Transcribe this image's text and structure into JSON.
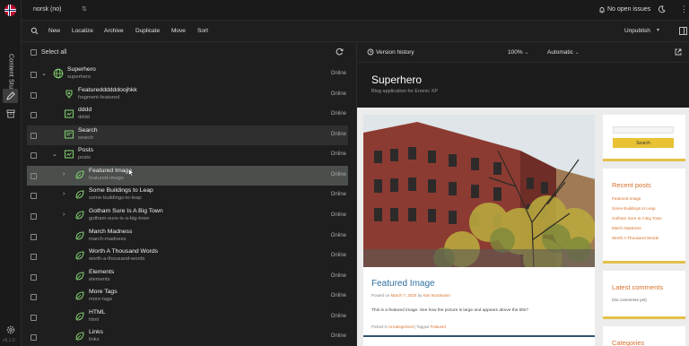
{
  "app": {
    "rail_title": "Content Studio",
    "version": "v5.1.0",
    "project": "norsk (no)",
    "issues": "No open issues"
  },
  "toolbar": {
    "buttons": [
      "New",
      "Localize",
      "Archive",
      "Duplicate",
      "Move",
      "Sort"
    ],
    "publish": "Unpublish"
  },
  "tree": {
    "select_all": "Select all",
    "rows": [
      {
        "name": "Superhero",
        "path": "superhero",
        "status": "Online",
        "level": 0,
        "expander": "open",
        "icon": "globe-icon"
      },
      {
        "name": "Featureddddddoojhkk",
        "path": "fragment-featured",
        "status": "Online",
        "level": 1,
        "expander": "none",
        "icon": "fragment-icon"
      },
      {
        "name": "dddd",
        "path": "dddd",
        "status": "Online",
        "level": 1,
        "expander": "none",
        "icon": "folder-icon"
      },
      {
        "name": "Search",
        "path": "search",
        "status": "Online",
        "level": 1,
        "expander": "none",
        "icon": "page-icon"
      },
      {
        "name": "Posts",
        "path": "posts",
        "status": "Online",
        "level": 1,
        "expander": "open",
        "icon": "folder-icon"
      },
      {
        "name": "Featured Image",
        "path": "featured-image",
        "status": "Online",
        "level": 2,
        "expander": "closed",
        "icon": "post-icon"
      },
      {
        "name": "Some Buildings to Leap",
        "path": "some-buildings-to-leap",
        "status": "Online",
        "level": 2,
        "expander": "closed",
        "icon": "post-icon"
      },
      {
        "name": "Gotham Sure Is A Big Town",
        "path": "gotham-sure-is-a-big-town",
        "status": "Online",
        "level": 2,
        "expander": "closed",
        "icon": "post-icon"
      },
      {
        "name": "March Madness",
        "path": "march-madness",
        "status": "Online",
        "level": 2,
        "expander": "none",
        "icon": "post-icon"
      },
      {
        "name": "Worth A Thousand Words",
        "path": "worth-a-thousand-words",
        "status": "Online",
        "level": 2,
        "expander": "none",
        "icon": "post-icon"
      },
      {
        "name": "Elements",
        "path": "elements",
        "status": "Online",
        "level": 2,
        "expander": "none",
        "icon": "post-icon"
      },
      {
        "name": "More Tags",
        "path": "more-tags",
        "status": "Online",
        "level": 2,
        "expander": "none",
        "icon": "post-icon"
      },
      {
        "name": "HTML",
        "path": "html",
        "status": "Online",
        "level": 2,
        "expander": "none",
        "icon": "post-icon"
      },
      {
        "name": "Links",
        "path": "links",
        "status": "Online",
        "level": 2,
        "expander": "none",
        "icon": "post-icon"
      }
    ]
  },
  "preview_bar": {
    "version_history": "Version history",
    "zoom": "100%",
    "device": "Automatic"
  },
  "site": {
    "title": "Superhero",
    "tagline": "Blog application for Enonic XP",
    "post": {
      "title": "Featured Image",
      "meta_prefix": "Posted on",
      "date": "March 7, 2020",
      "meta_by": "by",
      "author": "Kari Nordmann",
      "body": "This is a featured image. See how the picture is large and appears above the title?",
      "foot_prefix": "Posted in",
      "category": "Uncategorized",
      "tags_sep": "| Tagged",
      "tag": "Featured"
    },
    "search_button": "Search",
    "recent_title": "Recent posts",
    "recent": [
      "Featured Image",
      "Some Buildings to Leap",
      "Gotham Sure Is A Big Town",
      "March Madness",
      "Worth A Thousand Words"
    ],
    "comments_title": "Latest comments",
    "comments_empty": "(No comments yet)",
    "categories_title": "Categories"
  },
  "colors": {
    "accent_link": "#d8702a",
    "post_title": "#2f6e9e",
    "widget_border": "#e3c04a",
    "icon_green": "#7fc86e"
  }
}
